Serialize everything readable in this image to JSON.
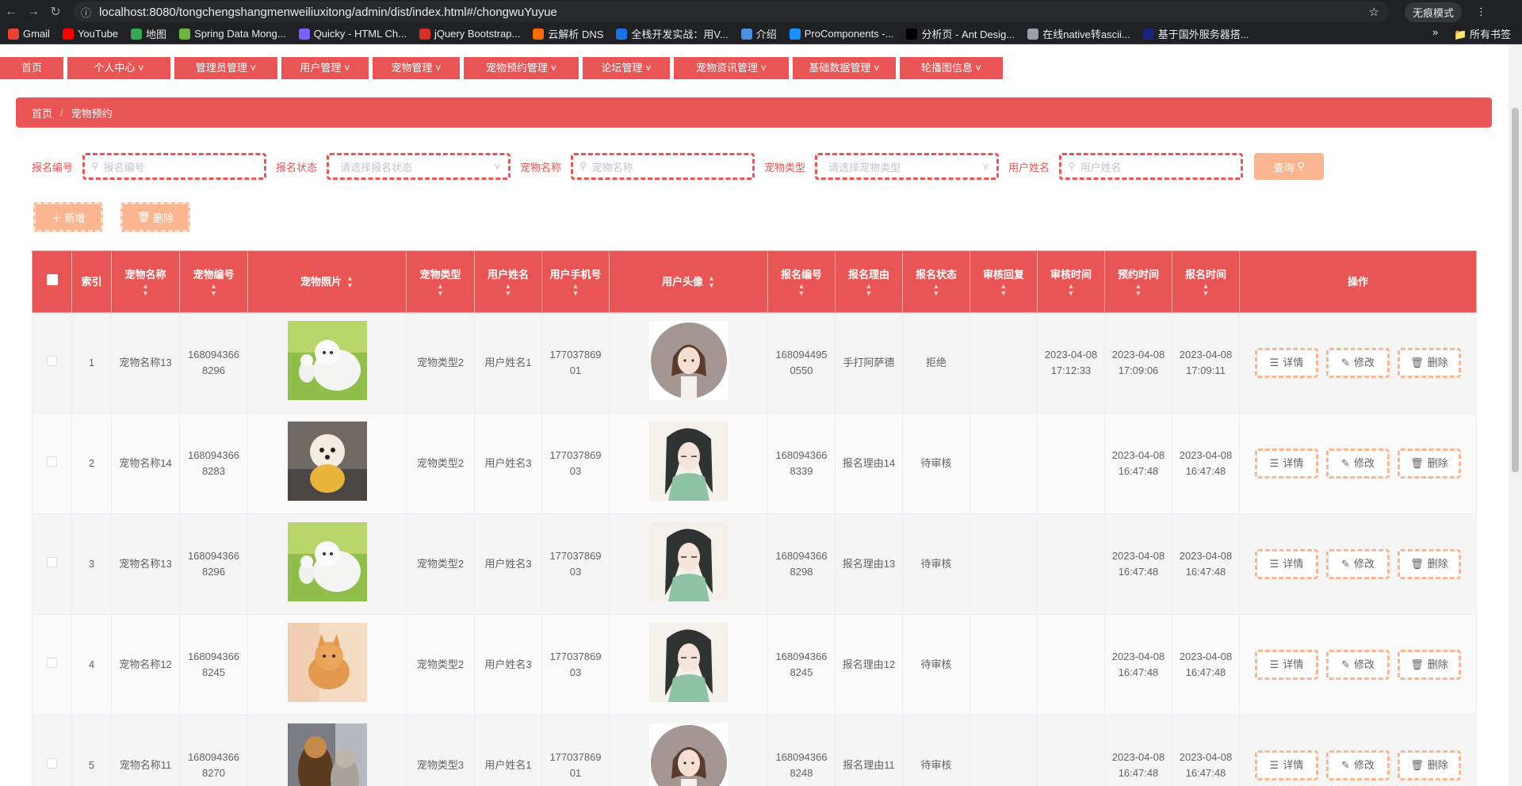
{
  "browser": {
    "url": "localhost:8080/tongchengshangmenweiliuxitong/admin/dist/index.html#/chongwuYuyue",
    "incognito_label": "无痕模式",
    "bookmarks": [
      {
        "label": "Gmail",
        "color": "#ea4335"
      },
      {
        "label": "YouTube",
        "color": "#ff0000"
      },
      {
        "label": "地图",
        "color": "#34a853"
      },
      {
        "label": "Spring Data Mong...",
        "color": "#6db33f"
      },
      {
        "label": "Quicky - HTML Ch...",
        "color": "#7b61ff"
      },
      {
        "label": "jQuery Bootstrap...",
        "color": "#d93025"
      },
      {
        "label": "云解析 DNS",
        "color": "#ff6a00"
      },
      {
        "label": "全栈开发实战：用V...",
        "color": "#1a73e8"
      },
      {
        "label": "介绍",
        "color": "#4a90e2"
      },
      {
        "label": "ProComponents -...",
        "color": "#1890ff"
      },
      {
        "label": "分析页 - Ant Desig...",
        "color": "#000000"
      },
      {
        "label": "在线native转ascii...",
        "color": "#9aa0a6"
      },
      {
        "label": "基于国外服务器搭...",
        "color": "#1a237e"
      }
    ],
    "all_bookmarks": "所有书签"
  },
  "menu": [
    "首页",
    "个人中心",
    "管理员管理",
    "用户管理",
    "宠物管理",
    "宠物预约管理",
    "论坛管理",
    "宠物资讯管理",
    "基础数据管理",
    "轮播图信息"
  ],
  "breadcrumb": {
    "home": "首页",
    "current": "宠物预约"
  },
  "search": {
    "fields": [
      {
        "label": "报名编号",
        "placeholder": "报名编号",
        "type": "input"
      },
      {
        "label": "报名状态",
        "placeholder": "请选择报名状态",
        "type": "select"
      },
      {
        "label": "宠物名称",
        "placeholder": "宠物名称",
        "type": "input"
      },
      {
        "label": "宠物类型",
        "placeholder": "请选择宠物类型",
        "type": "select"
      },
      {
        "label": "用户姓名",
        "placeholder": "用户姓名",
        "type": "input"
      }
    ],
    "query_button": "查询"
  },
  "actions": {
    "add": "新增",
    "delete": "删除"
  },
  "table": {
    "headers": [
      "索引",
      "宠物名称",
      "宠物编号",
      "宠物照片",
      "宠物类型",
      "用户姓名",
      "用户手机号",
      "用户头像",
      "报名编号",
      "报名理由",
      "报名状态",
      "审核回复",
      "审核时间",
      "预约时间",
      "报名时间",
      "操作"
    ],
    "op_labels": {
      "detail": "详情",
      "edit": "修改",
      "delete": "删除"
    },
    "rows": [
      {
        "index": "1",
        "pet_name": "宠物名称13",
        "pet_no": "1680943668296",
        "pet_photo": "white-dog",
        "pet_type": "宠物类型2",
        "user_name": "用户姓名1",
        "phone": "17703786901",
        "avatar": "girl-short-hair",
        "apply_no": "1680944950550",
        "reason": "手打阿萨德",
        "status": "拒绝",
        "reply": "",
        "audit_time": "2023-04-08 17:12:33",
        "book_time": "2023-04-08 17:09:06",
        "apply_time": "2023-04-08 17:09:11"
      },
      {
        "index": "2",
        "pet_name": "宠物名称14",
        "pet_no": "1680943668283",
        "pet_photo": "puppy-sweater",
        "pet_type": "宠物类型2",
        "user_name": "用户姓名3",
        "phone": "17703786903",
        "avatar": "girl-long-hair",
        "apply_no": "1680943668339",
        "reason": "报名理由14",
        "status": "待审核",
        "reply": "",
        "audit_time": "",
        "book_time": "2023-04-08 16:47:48",
        "apply_time": "2023-04-08 16:47:48"
      },
      {
        "index": "3",
        "pet_name": "宠物名称13",
        "pet_no": "1680943668296",
        "pet_photo": "white-dog",
        "pet_type": "宠物类型2",
        "user_name": "用户姓名3",
        "phone": "17703786903",
        "avatar": "girl-long-hair",
        "apply_no": "1680943668298",
        "reason": "报名理由13",
        "status": "待审核",
        "reply": "",
        "audit_time": "",
        "book_time": "2023-04-08 16:47:48",
        "apply_time": "2023-04-08 16:47:48"
      },
      {
        "index": "4",
        "pet_name": "宠物名称12",
        "pet_no": "1680943668245",
        "pet_photo": "orange-cat",
        "pet_type": "宠物类型2",
        "user_name": "用户姓名3",
        "phone": "17703786903",
        "avatar": "girl-long-hair",
        "apply_no": "1680943668245",
        "reason": "报名理由12",
        "status": "待审核",
        "reply": "",
        "audit_time": "",
        "book_time": "2023-04-08 16:47:48",
        "apply_time": "2023-04-08 16:47:48"
      },
      {
        "index": "5",
        "pet_name": "宠物名称11",
        "pet_no": "1680943668270",
        "pet_photo": "dog-and-cat",
        "pet_type": "宠物类型3",
        "user_name": "用户姓名1",
        "phone": "17703786901",
        "avatar": "girl-short-hair",
        "apply_no": "1680943668248",
        "reason": "报名理由11",
        "status": "待审核",
        "reply": "",
        "audit_time": "",
        "book_time": "2023-04-08 16:47:48",
        "apply_time": "2023-04-08 16:47:48"
      }
    ]
  },
  "colors": {
    "primary": "#e95555",
    "accent": "#fbb590"
  }
}
